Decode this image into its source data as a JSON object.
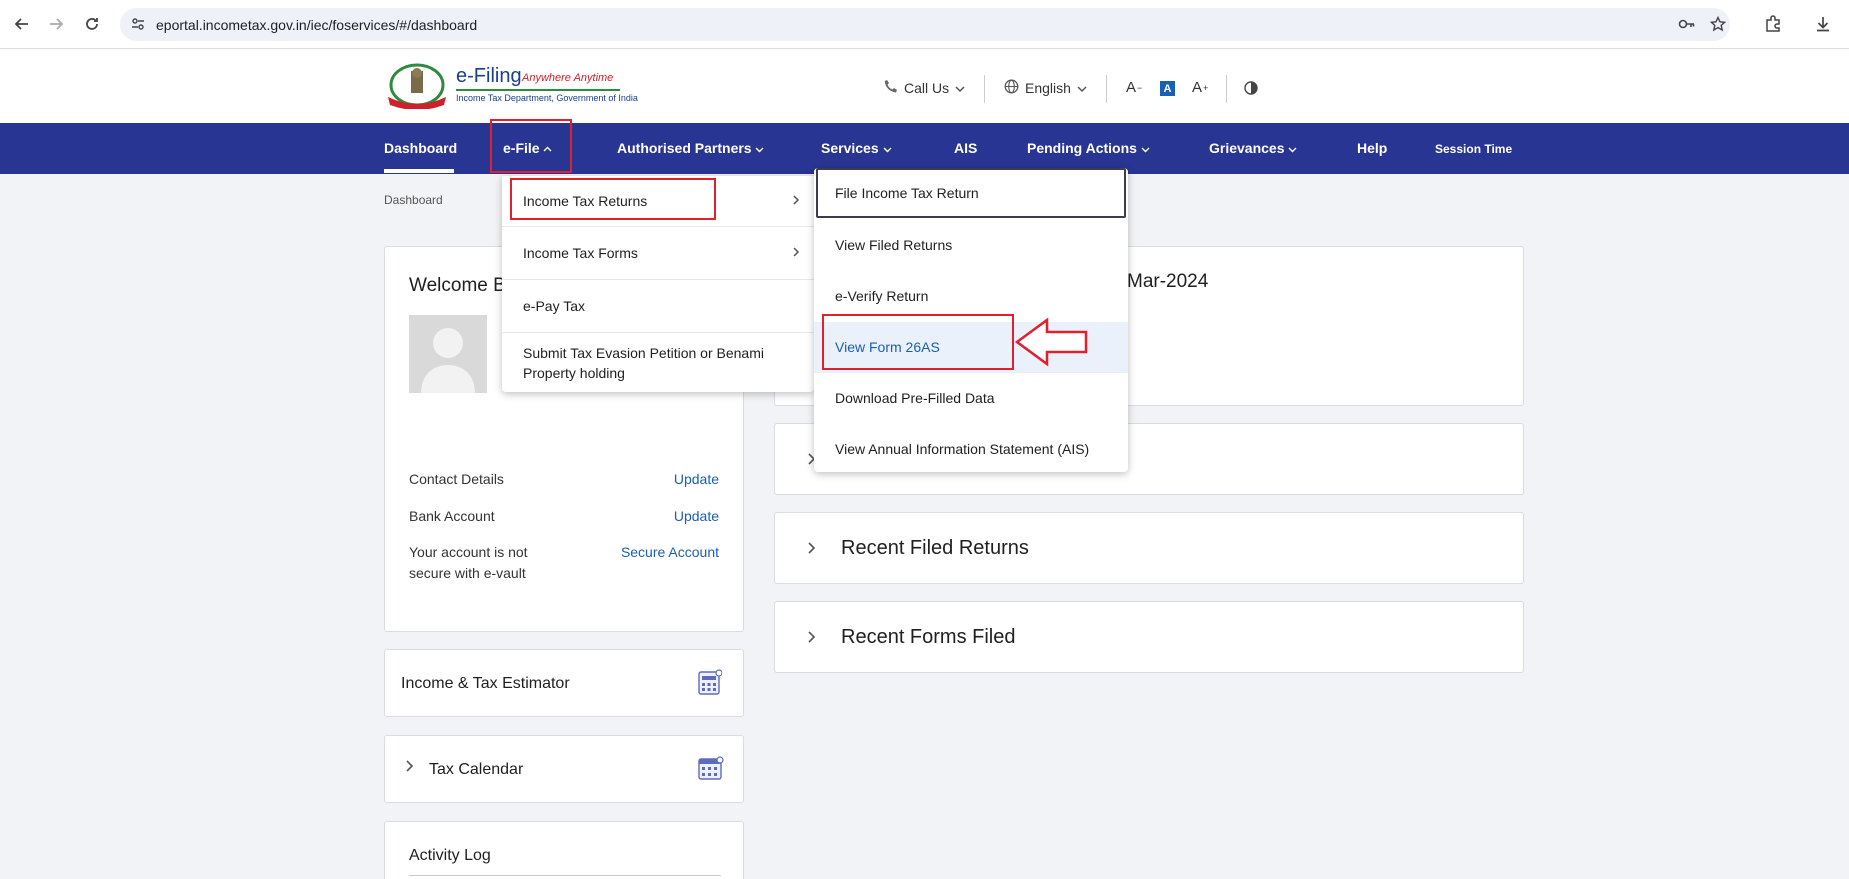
{
  "browser": {
    "url": "eportal.incometax.gov.in/iec/foservices/#/dashboard"
  },
  "header": {
    "logo_title": "e-Filing",
    "logo_tagline": "Anywhere Anytime",
    "logo_subtitle": "Income Tax Department, Government of India",
    "call_us": "Call Us",
    "language": "English",
    "font_decrease": "A",
    "font_normal": "A",
    "font_increase": "A"
  },
  "navbar": {
    "items": [
      "Dashboard",
      "e-File",
      "Authorised Partners",
      "Services",
      "AIS",
      "Pending Actions",
      "Grievances",
      "Help",
      "Session Time"
    ]
  },
  "breadcrumb": "Dashboard",
  "profile_card": {
    "welcome": "Welcome B",
    "contact_label": "Contact Details",
    "contact_link": "Update",
    "bank_label": "Bank Account",
    "bank_link": "Update",
    "secure_label": "Your account is not secure with e-vault",
    "secure_link": "Secure Account"
  },
  "estimator_card": {
    "title": "Income & Tax Estimator"
  },
  "calendar_card": {
    "title": "Tax Calendar"
  },
  "activity_card": {
    "title": "Activity Log"
  },
  "main_cards": {
    "date_text": "Mar-2024",
    "recent_returns": "Recent Filed Returns",
    "recent_forms": "Recent Forms Filed"
  },
  "efile_menu": {
    "items": [
      "Income Tax Returns",
      "Income Tax Forms",
      "e-Pay Tax",
      "Submit Tax Evasion Petition or Benami Property holding"
    ]
  },
  "itr_submenu": {
    "items": [
      "File Income Tax Return",
      "View Filed Returns",
      "e-Verify Return",
      "View Form 26AS",
      "Download Pre-Filled Data",
      "View Annual Information Statement (AIS)"
    ]
  },
  "colors": {
    "navbar": "#283593",
    "link": "#1a5fb4",
    "annotation_red": "#e0202c"
  }
}
